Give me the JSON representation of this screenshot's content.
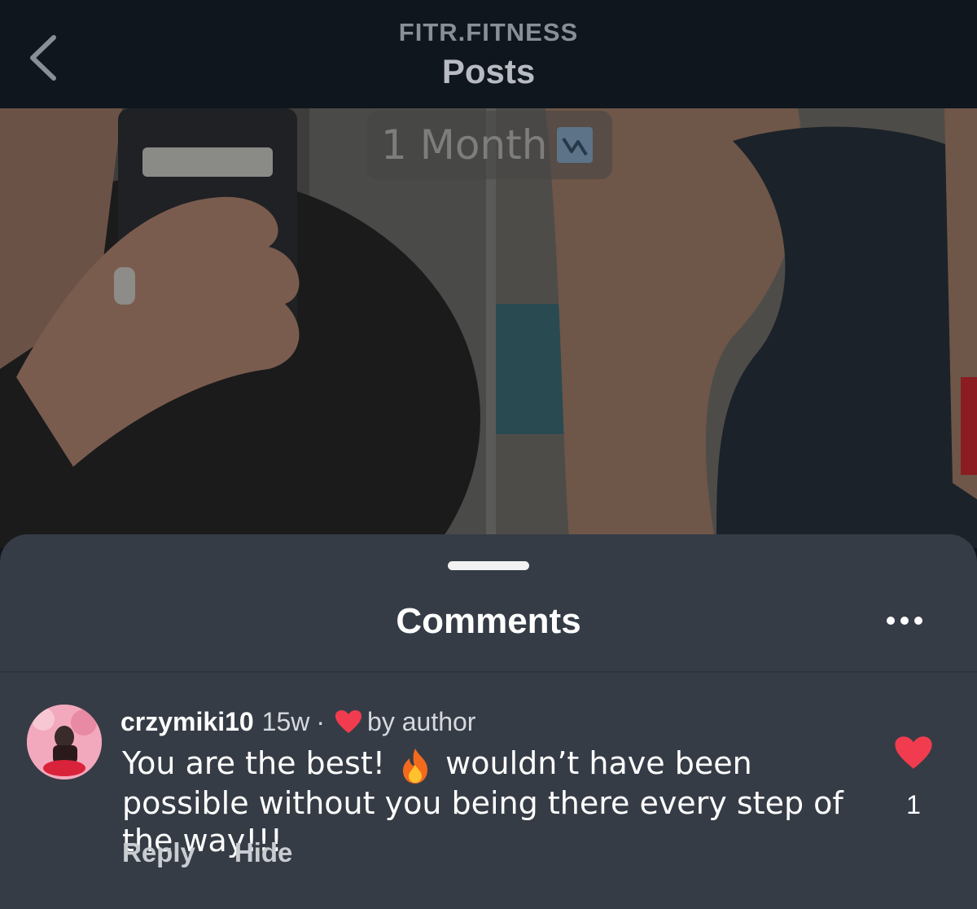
{
  "header": {
    "account_name": "FITR.FITNESS",
    "title": "Posts"
  },
  "post": {
    "overlay_text": "1 Month",
    "overlay_icon": "chart-icon"
  },
  "sheet": {
    "title": "Comments",
    "more_icon": "more-icon"
  },
  "comment": {
    "username": "crzymiki10",
    "time": "15w",
    "separator": "·",
    "liked_by_label": "by author",
    "text_part1": "You are the best!",
    "text_part2": "wouldn’t have been possible without you being there every step of the way!!!",
    "reply_label": "Reply",
    "hide_label": "Hide",
    "like_count": "1"
  },
  "colors": {
    "header_bg": "#0f161e",
    "sheet_bg": "#363c46",
    "heart": "#f13c4f"
  }
}
